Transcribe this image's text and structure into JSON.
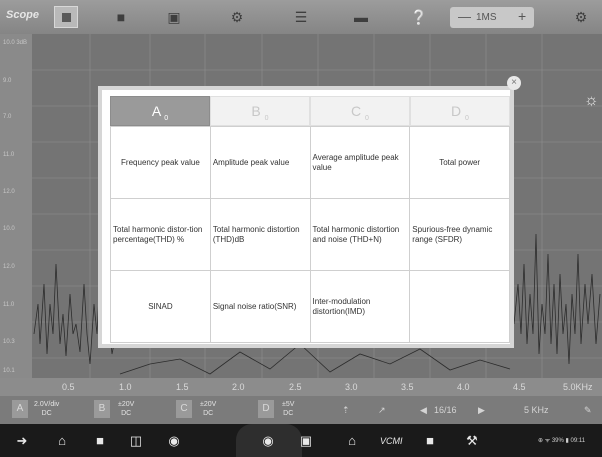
{
  "toolbar": {
    "title": "Scope",
    "timebase": {
      "minus": "—",
      "value": "1MS",
      "plus": "+"
    }
  },
  "plot": {
    "y_labels": [
      "10.0\n3dB",
      "9.0",
      "7.0",
      "11.0",
      "12.0",
      "10.0",
      "12.0",
      "11.0",
      "10.3",
      "10.1"
    ],
    "x_labels": [
      "0.5",
      "1.0",
      "1.5",
      "2.0",
      "2.5",
      "3.0",
      "3.5",
      "4.0",
      "4.5",
      "5.0KHz"
    ]
  },
  "dialog": {
    "close_symbol": "×",
    "tabs": [
      {
        "label": "A",
        "sub": "0",
        "active": true
      },
      {
        "label": "B",
        "sub": "0",
        "active": false
      },
      {
        "label": "C",
        "sub": "0",
        "active": false
      },
      {
        "label": "D",
        "sub": "0",
        "active": false
      }
    ],
    "rows": [
      [
        "Frequency peak value",
        "Amplitude peak value",
        "Average amplitude peak value",
        "Total power"
      ],
      [
        "Total harmonic distor-tion percentage(THD) %",
        "Total harmonic distortion (THD)dB",
        "Total harmonic distortion and noise (THD+N)",
        "Spurious-free dynamic range (SFDR)"
      ],
      [
        "SINAD",
        "Signal noise ratio(SNR)",
        "Inter-modulation distortion(IMD)",
        ""
      ]
    ]
  },
  "channels": [
    {
      "letter": "A",
      "line1": "2.0V/div",
      "line2": "DC"
    },
    {
      "letter": "B",
      "line1": "±20V",
      "line2": "DC"
    },
    {
      "letter": "C",
      "line1": "±20V",
      "line2": "DC"
    },
    {
      "letter": "D",
      "line1": "±5V",
      "line2": "DC"
    }
  ],
  "channel_extra": {
    "page": "16/16",
    "freq": "5 KHz"
  },
  "status_bar": {
    "text": "⊕ ᯤ 39% ▮ 09:11"
  },
  "icons": {
    "stop": "stop-icon",
    "car": "car-icon",
    "calendar": "calendar-icon",
    "settings": "gear-icon",
    "menu": "menu-icon",
    "folder": "folder-icon",
    "help": "help-icon",
    "brightness": "brightness-icon"
  }
}
